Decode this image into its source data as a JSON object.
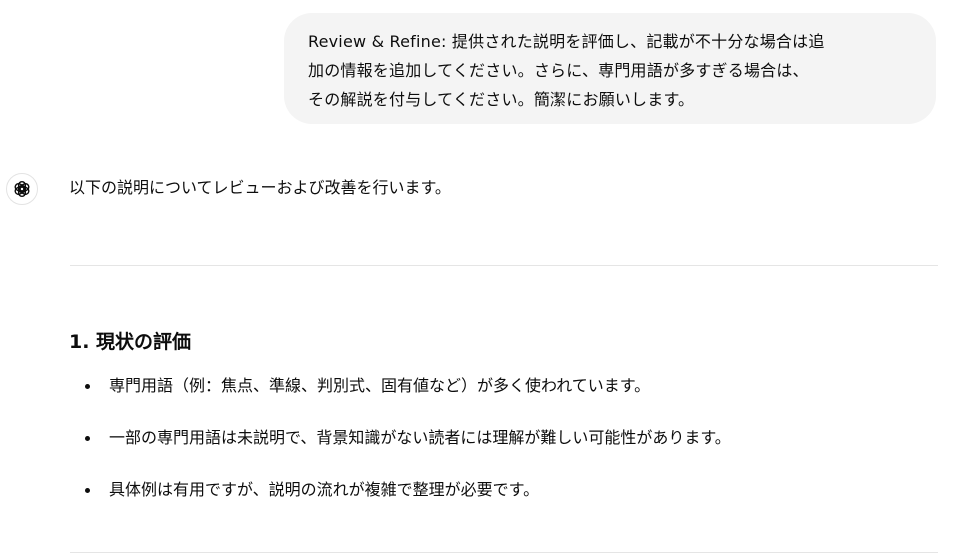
{
  "user_message": {
    "lines": [
      "Review & Refine: 提供された説明を評価し、記載が不十分な場合は追",
      "加の情報を追加してください。さらに、専門用語が多すぎる場合は、",
      "その解説を付与してください。簡潔にお願いします。"
    ]
  },
  "assistant": {
    "avatar_icon": "openai-logo-icon",
    "intro": "以下の説明についてレビューおよび改善を行います。",
    "section": {
      "heading": "1. 現状の評価",
      "bullets": [
        "専門用語（例：焦点、準線、判別式、固有値など）が多く使われています。",
        "一部の専門用語は未説明で、背景知識がない読者には理解が難しい可能性があります。",
        "具体例は有用ですが、説明の流れが複雑で整理が必要です。"
      ]
    }
  },
  "colors": {
    "bubble_bg": "#f4f4f4",
    "text": "#0d0d0d",
    "divider": "#e5e5e5"
  }
}
